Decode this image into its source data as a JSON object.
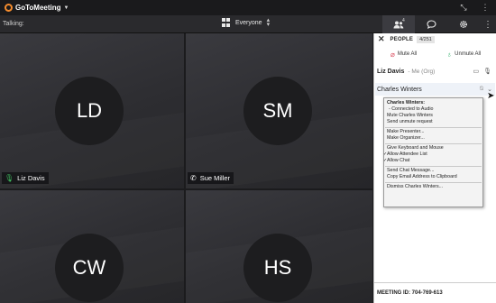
{
  "app": {
    "title": "GoToMeeting",
    "window_buttons": [
      "restore-icon",
      "more-icon"
    ]
  },
  "toolbar": {
    "talking_label": "Talking:",
    "view_label": "Everyone",
    "people_count": "4"
  },
  "tiles": [
    {
      "initials": "LD",
      "name": "Liz Davis",
      "audio": "mic"
    },
    {
      "initials": "SM",
      "name": "Sue Miller",
      "audio": "phone"
    },
    {
      "initials": "CW",
      "name": "",
      "audio": ""
    },
    {
      "initials": "HS",
      "name": "",
      "audio": ""
    }
  ],
  "panel": {
    "title": "PEOPLE",
    "count": "4/251",
    "mute_all": "Mute All",
    "unmute_all": "Unmute All",
    "me_name": "Liz Davis",
    "me_tag": "- Me (Org)",
    "selected_name": "Charles Winters",
    "meeting_id": "MEETING ID: 704-769-613"
  },
  "menu": {
    "header": "Charles Winters:",
    "status": "- Connected to Audio",
    "mute": "Mute Charles Winters",
    "unmute_request": "Send unmute request",
    "make_presenter": "Make Presenter...",
    "make_organizer": "Make Organizer...",
    "give_keyboard": "Give Keyboard and Mouse",
    "allow_attendee": "Allow Attendee List",
    "allow_chat": "Allow Chat",
    "send_chat": "Send Chat Message...",
    "copy_email": "Copy Email Address to Clipboard",
    "dismiss": "Dismiss Charles Winters..."
  },
  "colors": {
    "accent_orange": "#f68d2e",
    "mic_green": "#3fbf5f",
    "mute_red": "#d9485a",
    "unmute_green": "#31b06b"
  }
}
